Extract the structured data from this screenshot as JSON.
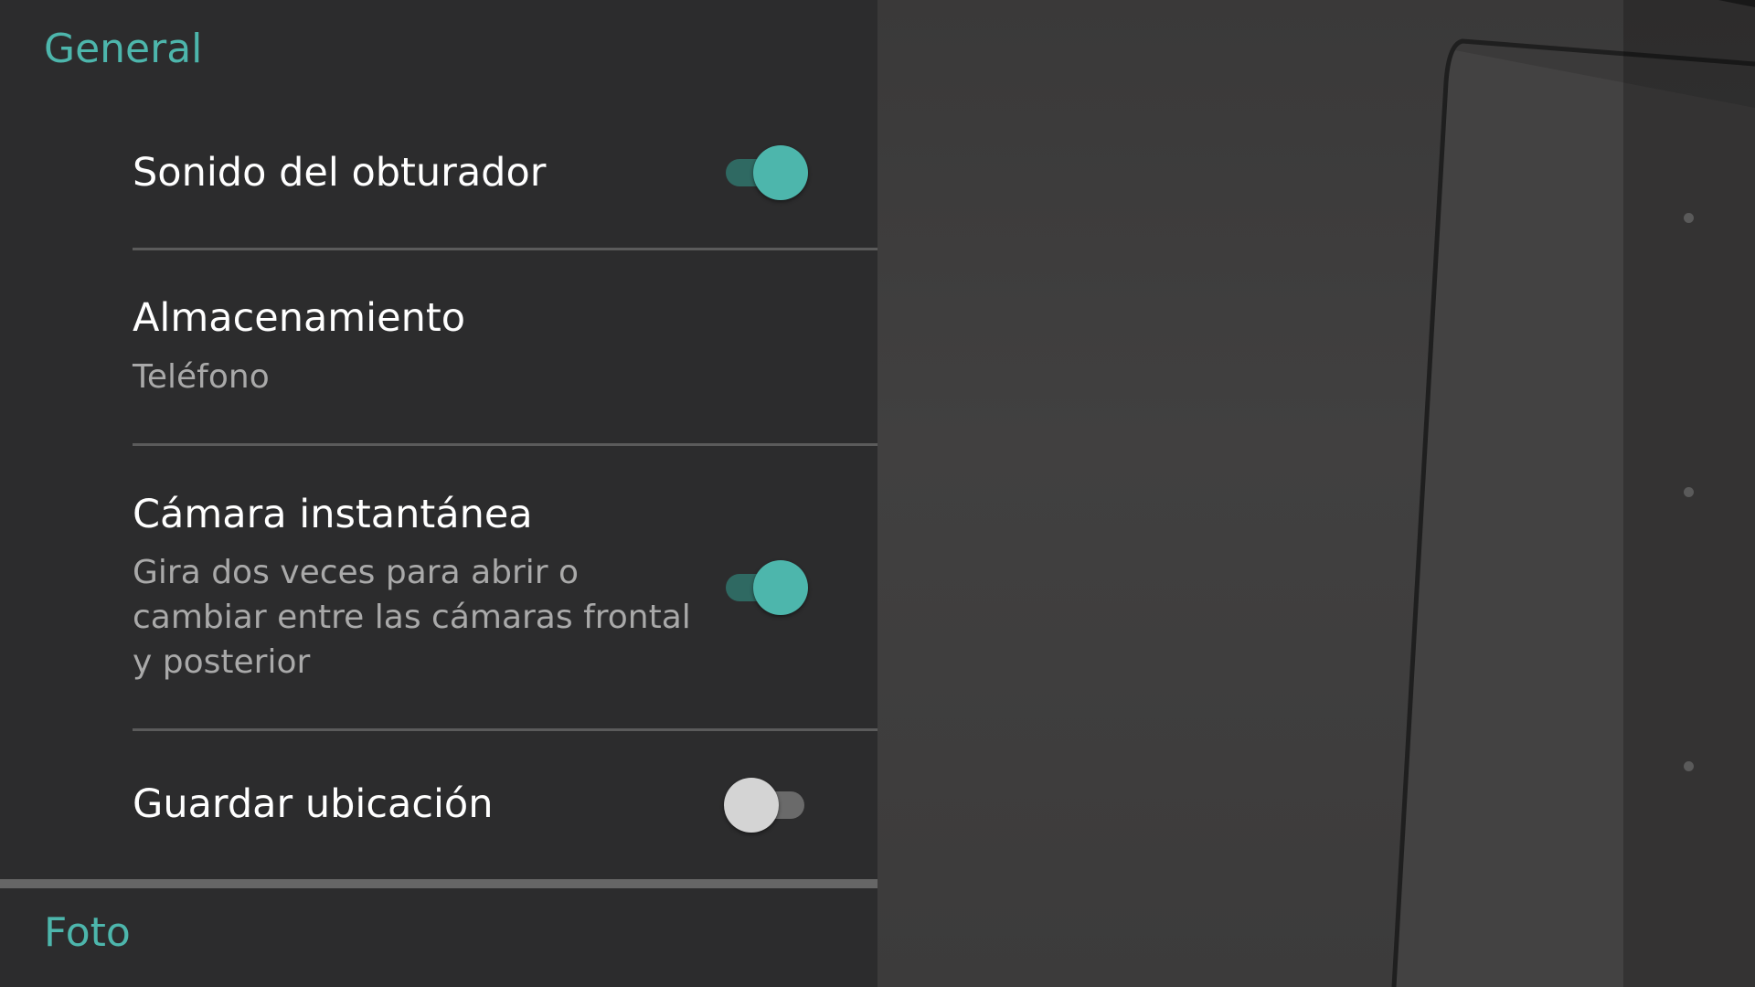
{
  "colors": {
    "accent": "#4db6ac",
    "panel_background": "#2c2c2d",
    "title_text": "#ffffff",
    "summary_text": "#a9a9a9",
    "switch_on_track": "#2f6962",
    "switch_off_thumb": "#d4d4d4"
  },
  "settings": {
    "sections": {
      "general": {
        "title": "General"
      },
      "foto": {
        "title": "Foto"
      }
    },
    "items": {
      "shutter_sound": {
        "title": "Sonido del obturador",
        "checked": true
      },
      "storage": {
        "title": "Almacenamiento",
        "summary": "Teléfono"
      },
      "quick_camera": {
        "title": "Cámara instantánea",
        "summary": "Gira dos veces para abrir o cambiar entre las cámaras frontal y posterior",
        "checked": true
      },
      "save_location": {
        "title": "Guardar ubicación",
        "checked": false
      }
    }
  },
  "icons": {
    "switch": "toggle-switch-icon"
  }
}
